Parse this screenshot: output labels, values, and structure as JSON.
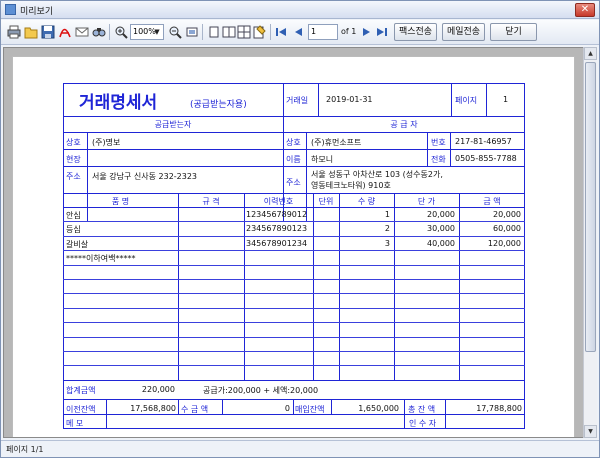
{
  "window": {
    "title": "미리보기",
    "close_label": "✕"
  },
  "toolbar": {
    "zoom_value": "100%",
    "page_input": "1",
    "page_of": "of 1",
    "fax_label": "팩스전송",
    "email_label": "메일전송",
    "close_label": "닫기"
  },
  "status": {
    "page_text": "페이지 1/1"
  },
  "invoice": {
    "title": "거래명세서",
    "subtitle": "(공급받는자용)",
    "date_label": "거래일",
    "date": "2019-01-31",
    "page_label": "페이지",
    "page_no": "1",
    "receiver_header": "공급받는자",
    "supplier_header": "공 급 자",
    "recv_name_label": "상호",
    "recv_name": "(주)명보",
    "recv_site_label": "현장",
    "recv_addr_label": "주소",
    "recv_addr": "서울 강남구 신사동 232-2323",
    "sup_name_label": "상호",
    "sup_name": "(주)휴먼소프트",
    "sup_regno_label": "번호",
    "sup_regno": "217-81-46957",
    "sup_person_label": "이름",
    "sup_person": "하모니",
    "sup_phone_label": "전화",
    "sup_phone": "0505-855-7788",
    "sup_addr_label": "주소",
    "sup_addr_line1": "서울 성동구 아차산로 103 (성수동2가,",
    "sup_addr_line2": "영동테크노타워) 910호",
    "columns": {
      "item": "품  명",
      "spec": "규  격",
      "history": "이력번호",
      "unit": "단위",
      "qty": "수  량",
      "price": "단  가",
      "amount": "금  액"
    },
    "items": [
      {
        "name": "안심",
        "history": "123456789012",
        "qty": "1",
        "price": "20,000",
        "amount": "20,000"
      },
      {
        "name": "등심",
        "history": "234567890123",
        "qty": "2",
        "price": "30,000",
        "amount": "60,000"
      },
      {
        "name": "갈비살",
        "history": "345678901234",
        "qty": "3",
        "price": "40,000",
        "amount": "120,000"
      }
    ],
    "blank_line": "*****이하여백*****",
    "total_label": "합계금액",
    "total": "220,000",
    "total_detail": "공급가:200,000 + 세액:20,000",
    "prev_balance_label": "이전잔액",
    "prev_balance": "17,568,800",
    "received_label": "수 금 액",
    "received": "0",
    "sales_balance_label": "매입잔액",
    "sales_balance": "1,650,000",
    "total_balance_label": "총 잔 액",
    "total_balance": "17,788,800",
    "memo_label": "메  모",
    "receiver_sign_label": "인 수 자"
  }
}
